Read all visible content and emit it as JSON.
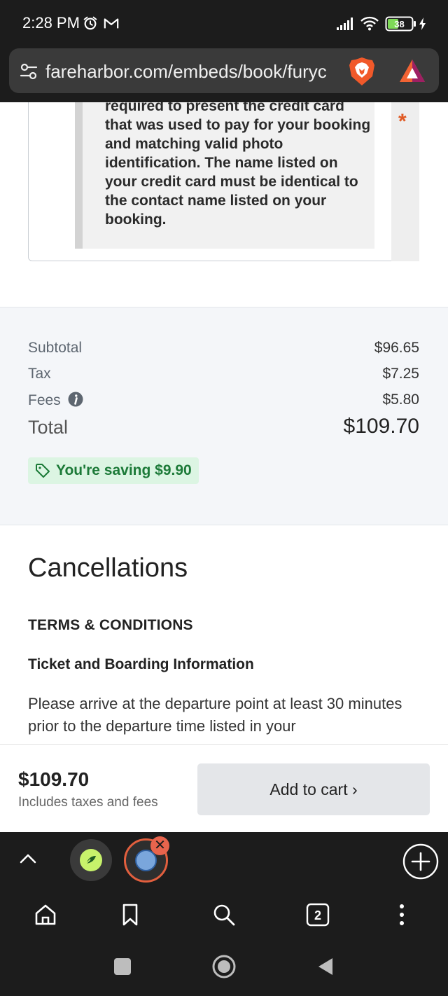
{
  "status_bar": {
    "time": "2:28 PM",
    "battery": "38",
    "icons": [
      "alarm-icon",
      "gmail-icon",
      "signal-icon",
      "wifi-icon",
      "battery-icon",
      "charging-icon"
    ]
  },
  "address_bar": {
    "url": "fareharbor.com/embeds/book/furyc",
    "icons": [
      "site-settings-icon",
      "brave-shields-icon",
      "brave-rewards-icon"
    ]
  },
  "notice": {
    "text": "required to present the credit card that was used to pay for your booking and matching valid photo identification. The name listed on your credit card must be identical to the contact name listed on your booking.",
    "required_marker": "*"
  },
  "summary": {
    "subtotal_label": "Subtotal",
    "subtotal_value": "$96.65",
    "tax_label": "Tax",
    "tax_value": "$7.25",
    "fees_label": "Fees",
    "fees_value": "$5.80",
    "total_label": "Total",
    "total_value": "$109.70",
    "saving_text": "You're saving $9.90"
  },
  "cancellations": {
    "title": "Cancellations",
    "terms_heading": "TERMS & CONDITIONS",
    "ticket_heading": "Ticket and Boarding Information",
    "ticket_body": "Please arrive at the departure point at least 30 minutes prior to the departure time listed in your"
  },
  "cart": {
    "price": "$109.70",
    "sub": "Includes taxes and fees",
    "button": "Add to cart ›"
  },
  "browser": {
    "tab_count": "2",
    "tab_close": "✕"
  },
  "colors": {
    "accent_orange": "#e05a24",
    "saving_green": "#1c7a38",
    "saving_bg": "#dcf5e3",
    "chrome_dark": "#1c1c1c"
  }
}
